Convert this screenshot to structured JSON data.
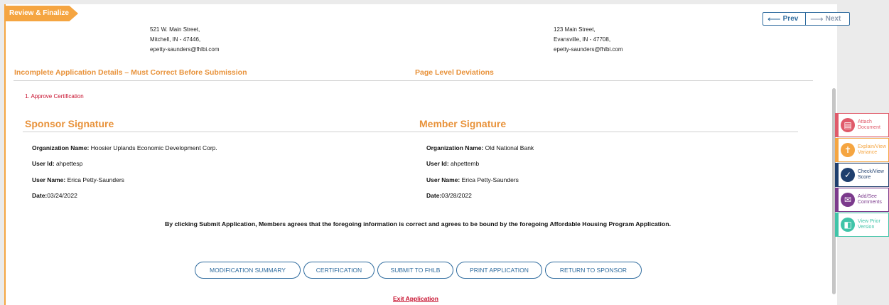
{
  "step_tab": "Review & Finalize",
  "nav": {
    "prev": "Prev",
    "next": "Next"
  },
  "sponsor_address": {
    "line1": "521 W. Main Street,",
    "line2": "Mitchell, IN - 47446,",
    "line3": "epetty-saunders@fhlbi.com"
  },
  "member_address": {
    "line1": "123 Main Street,",
    "line2": "Evansville, IN - 47708,",
    "line3": "epetty-saunders@fhlbi.com"
  },
  "incomplete_heading": "Incomplete Application Details – Must Correct Before Submission",
  "deviations_heading": "Page Level Deviations",
  "incomplete_items": [
    {
      "number": "1.",
      "text": "Approve Certification"
    }
  ],
  "sponsor": {
    "title": "Sponsor Signature",
    "org_label": "Organization Name:",
    "org_value": " Hoosier Uplands Economic Development Corp.",
    "user_id_label": "User Id:",
    "user_id_value": " ahpettesp",
    "user_name_label": "User Name:",
    "user_name_value": " Erica Petty-Saunders",
    "date_label": "Date:",
    "date_value": "03/24/2022"
  },
  "member": {
    "title": "Member Signature",
    "org_label": "Organization Name:",
    "org_value": " Old National Bank",
    "user_id_label": "User Id:",
    "user_id_value": " ahpettemb",
    "user_name_label": "User Name:",
    "user_name_value": " Erica Petty-Saunders",
    "date_label": "Date:",
    "date_value": "03/28/2022"
  },
  "agreement_text": "By clicking Submit Application, Members agrees that the foregoing information is correct and agrees to be bound by the foregoing Affordable Housing Program Application.",
  "actions": {
    "modification_summary": "MODIFICATION SUMMARY",
    "certification": "CERTIFICATION",
    "submit": "SUBMIT TO FHLB",
    "print": "PRINT APPLICATION",
    "return": "RETURN TO SPONSOR"
  },
  "exit_link": "Exit Application",
  "side_tools": [
    {
      "line1": "Attach",
      "line2": "Document",
      "color": "#e05a6a",
      "icon": "document-icon"
    },
    {
      "line1": "Explain/View",
      "line2": "Variance",
      "color": "#f5a541",
      "icon": "variance-icon"
    },
    {
      "line1": "Check/View",
      "line2": "Score",
      "color": "#1f3f6e",
      "icon": "check-icon"
    },
    {
      "line1": "Add/See",
      "line2": "Comments",
      "color": "#7b3a8c",
      "icon": "comment-icon"
    },
    {
      "line1": "View Prior",
      "line2": "Version",
      "color": "#3fc4a8",
      "icon": "prior-version-icon"
    }
  ]
}
